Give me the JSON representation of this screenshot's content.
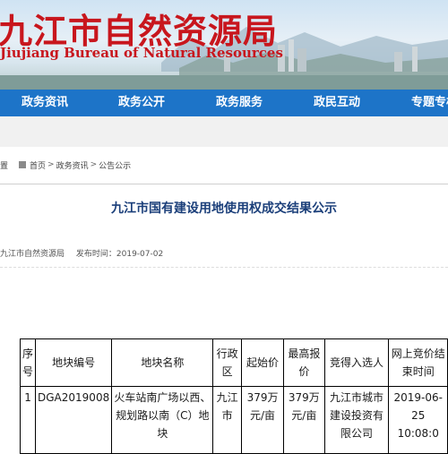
{
  "header": {
    "title": "九江市自然资源局",
    "subtitle": "Jiujiang Bureau of Natural Resources"
  },
  "nav": {
    "items": [
      {
        "label": "政务资讯"
      },
      {
        "label": "政务公开"
      },
      {
        "label": "政务服务"
      },
      {
        "label": "政民互动"
      },
      {
        "label": "专题专栏"
      }
    ]
  },
  "breadcrumb": {
    "prefix": "置",
    "items": [
      "首页",
      "政务资讯",
      "公告公示"
    ],
    "separator": ">"
  },
  "article": {
    "title": "九江市国有建设用地使用权成交结果公示",
    "source": "九江市自然资源局",
    "date_label": "发布时间：",
    "date": "2019-07-02"
  },
  "table": {
    "headers": [
      "序号",
      "地块编号",
      "地块名称",
      "行政区",
      "起始价",
      "最高报价",
      "竞得入选人",
      "网上竞价结束时间"
    ],
    "rows": [
      [
        "1",
        "DGA2019008",
        "火车站南广场以西、规划路以南（C）地块",
        "九江市",
        "379万元/亩",
        "379万元/亩",
        "九江市城市建设投资有限公司",
        "2019-06-25 10:08:0"
      ]
    ]
  },
  "colors": {
    "title_red": "#c8161d",
    "nav_blue": "#1d74c8",
    "article_title_blue": "#1b3f7a"
  }
}
